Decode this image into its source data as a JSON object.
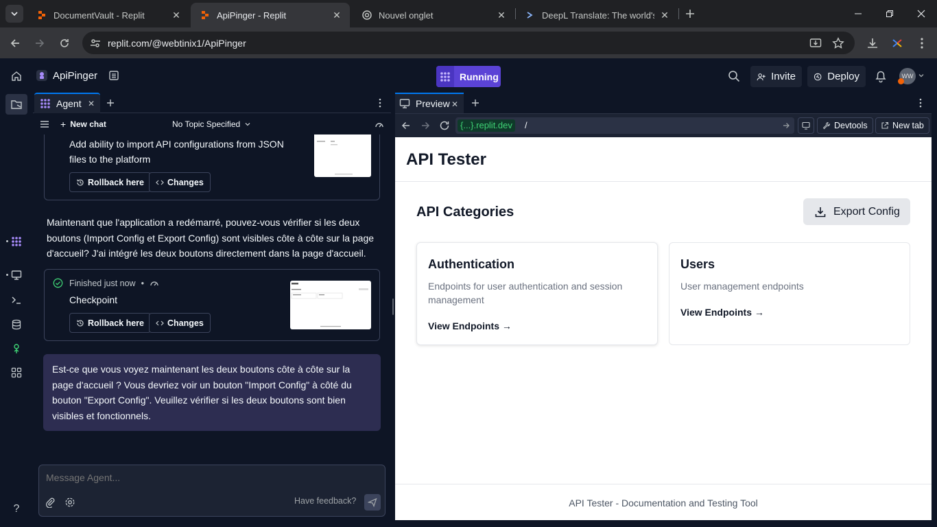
{
  "browser": {
    "tabs": [
      {
        "title": "DocumentVault - Replit",
        "icon": "replit-icon"
      },
      {
        "title": "ApiPinger - Replit",
        "icon": "replit-icon"
      },
      {
        "title": "Nouvel onglet",
        "icon": "chrome-icon"
      },
      {
        "title": "DeepL Translate: The world's m",
        "icon": "deepl-icon"
      }
    ],
    "close_glyph": "✕",
    "address": "replit.com/@webtinix1/ApiPinger"
  },
  "replit_header": {
    "repl_name": "ApiPinger",
    "run_label": "Running",
    "invite_label": "Invite",
    "deploy_label": "Deploy",
    "user_initials": "WW"
  },
  "agent": {
    "tab_label": "Agent",
    "new_chat_label": "New chat",
    "topic_label": "No Topic Specified",
    "checkpoint_1": {
      "title": "Add ability to import API configurations from JSON files to the platform",
      "rollback_label": "Rollback here",
      "changes_label": "Changes"
    },
    "agent_message": "Maintenant que l'application a redémarré, pouvez-vous vérifier si les deux boutons (Import Config et Export Config) sont visibles côte à côte sur la page d'accueil? J'ai intégré les deux boutons directement dans la page d'accueil.",
    "checkpoint_2": {
      "status": "Finished just now",
      "dot": "•",
      "title": "Checkpoint",
      "rollback_label": "Rollback here",
      "changes_label": "Changes"
    },
    "user_message": "Est-ce que vous voyez maintenant les deux boutons côte à côte sur la page d'accueil ? Vous devriez voir un bouton \"Import Config\" à côté du bouton \"Export Config\". Veuillez vérifier si les deux boutons sont bien visibles et fonctionnels.",
    "composer_placeholder": "Message Agent...",
    "feedback_label": "Have feedback?"
  },
  "preview": {
    "tab_label": "Preview",
    "url_host": "{...}.replit.dev",
    "url_path": "/",
    "devtools_label": "Devtools",
    "newtab_label": "New tab"
  },
  "webpage": {
    "title": "API Tester",
    "section_title": "API Categories",
    "export_button": "Export Config",
    "cards": [
      {
        "title": "Authentication",
        "description": "Endpoints for user authentication and session management",
        "link": "View Endpoints →"
      },
      {
        "title": "Users",
        "description": "User management endpoints",
        "link": "View Endpoints →"
      }
    ],
    "footer": "API Tester - Documentation and Testing Tool"
  },
  "rail": {
    "help_label": "?"
  },
  "colors": {
    "replit_bg": "#0e1525",
    "panel_bg": "#1c2333",
    "run_purple": "#5b43d6",
    "user_bubble": "#2d2d51",
    "accent_blue": "#0079f2",
    "success_green": "#3fd375"
  }
}
